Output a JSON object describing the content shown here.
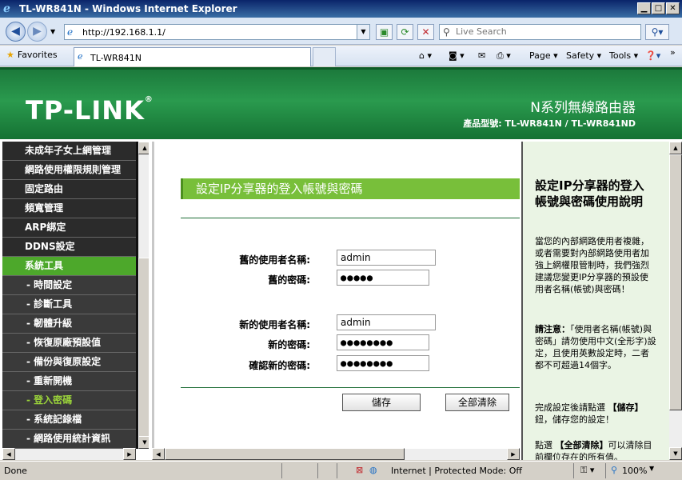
{
  "window": {
    "title": "TL-WR841N - Windows Internet Explorer"
  },
  "browser": {
    "address": "http://192.168.1.1/",
    "search_placeholder": "Live Search",
    "favorites_label": "Favorites",
    "tab_title": "TL-WR841N",
    "commands": {
      "page": "Page",
      "safety": "Safety",
      "tools": "Tools"
    }
  },
  "header": {
    "logo": "TP-LINK",
    "product": "N系列無線路由器",
    "model": "產品型號: TL-WR841N / TL-WR841ND"
  },
  "sidebar": {
    "items": [
      {
        "label": "未成年子女上網管理",
        "type": "top"
      },
      {
        "label": "網路使用權限規則管理",
        "type": "top"
      },
      {
        "label": "固定路由",
        "type": "top"
      },
      {
        "label": "頻寬管理",
        "type": "top"
      },
      {
        "label": "ARP綁定",
        "type": "top"
      },
      {
        "label": "DDNS設定",
        "type": "top"
      },
      {
        "label": "系統工具",
        "type": "active"
      },
      {
        "label": "- 時間設定",
        "type": "sub"
      },
      {
        "label": "- 診斷工具",
        "type": "sub"
      },
      {
        "label": "- 韌體升級",
        "type": "sub"
      },
      {
        "label": "- 恢復原廠預設值",
        "type": "sub"
      },
      {
        "label": "- 備份與復原設定",
        "type": "sub"
      },
      {
        "label": "- 重新開機",
        "type": "sub"
      },
      {
        "label": "- 登入密碼",
        "type": "current"
      },
      {
        "label": "- 系統記錄檔",
        "type": "sub"
      },
      {
        "label": "- 網路使用統計資訊",
        "type": "sub"
      }
    ]
  },
  "main": {
    "title": "設定IP分享器的登入帳號與密碼",
    "old_user_label": "舊的使用者名稱:",
    "old_user_value": "admin",
    "old_pass_label": "舊的密碼:",
    "old_pass_value": "●●●●●",
    "new_user_label": "新的使用者名稱:",
    "new_user_value": "admin",
    "new_pass_label": "新的密碼:",
    "new_pass_value": "●●●●●●●●",
    "confirm_pass_label": "確認新的密碼:",
    "confirm_pass_value": "●●●●●●●●",
    "save_label": "儲存",
    "clear_label": "全部清除"
  },
  "help": {
    "title": "設定IP分享器的登入帳號與密碼使用說明",
    "p1": "當您的內部網路使用者複雜，或者需要對內部網路使用者加強上網權限管制時，我們強烈建議您變更IP分享器的預設使用者名稱(帳號)與密碼！",
    "p2_bold": "請注意：",
    "p2": "「使用者名稱(帳號)與密碼」請勿使用中文(全形字)設定，且使用英數設定時，二者都不可超過14個字。",
    "p3_a": "完成設定後請點選",
    "p3_bold": "【儲存】",
    "p3_b": "鈕，儲存您的設定！",
    "p4_a": "點選",
    "p4_bold": "【全部清除】",
    "p4_b": "可以清除目前欄位存在的所有值。"
  },
  "status": {
    "left": "Done",
    "zone": "Internet | Protected Mode: Off",
    "zoom": "100%"
  }
}
